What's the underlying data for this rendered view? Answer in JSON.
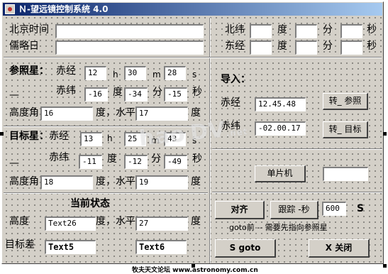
{
  "window": {
    "title": "Ｎ-望远镜控制系统 4.0"
  },
  "time": {
    "beijing_label": "北京时间",
    "julian_label": "儒略日",
    "beijing_value": "",
    "julian_value": ""
  },
  "location": {
    "lat_label": "北纬",
    "lon_label": "东经",
    "deg": "度",
    "min": "分",
    "sec": "秒",
    "lat_deg": "",
    "lat_min": "",
    "lat_sec": "",
    "lon_deg": "",
    "lon_min": "",
    "lon_sec": ""
  },
  "reference": {
    "title": "参照星：",
    "ra_label": "赤经",
    "dec_label": "赤纬",
    "h": "h",
    "m": "m",
    "s": "s",
    "deg": "度",
    "min": "分",
    "sec": "秒",
    "ra_h": "12",
    "ra_m": "30",
    "ra_s": "28",
    "dec_d": "-16",
    "dec_m": "-34",
    "dec_s": "-15",
    "alt_label": "高度角",
    "alt_value": "16",
    "az_label": "度，水平",
    "az_value": "17",
    "az_unit": "度",
    "dash": "—"
  },
  "target": {
    "title": "目标星：",
    "ra_label": "赤经",
    "dec_label": "赤纬",
    "h": "h",
    "m": "m",
    "s": "s",
    "deg": "度",
    "min": "分",
    "sec": "秒",
    "ra_h": "13",
    "ra_m": "25",
    "ra_s": "43",
    "dec_d": "-11",
    "dec_m": "-12",
    "dec_s": "-49",
    "alt_label": "高度角",
    "alt_value": "18",
    "az_label": "度，水平",
    "az_value": "19",
    "az_unit": "度",
    "dash": "—"
  },
  "import": {
    "title": "导入：",
    "ra_label": "赤经",
    "ra_value": "12.45.48",
    "ra_button": "转_ 参照",
    "dec_label": "赤纬",
    "dec_value": "-02.00.17",
    "dec_button": "转_ 目标",
    "mcu_button": "单片机",
    "mcu_value": ""
  },
  "status": {
    "title": "当前状态",
    "alt_label": "高度",
    "alt_value": "Text26",
    "az_label": "度，水平",
    "az_value": "27",
    "az_unit": "度",
    "diff_label": "目标差",
    "diff_alt": "Text5",
    "diff_az": "Text6"
  },
  "controls": {
    "align_button": "对齐",
    "track_button": "跟踪 -秒",
    "track_seconds": "600",
    "track_unit": "S",
    "goto_hint": "goto前 -- 需要先指向参照星",
    "goto_button": "S  goto",
    "close_button": "X 关闭"
  },
  "overlay": {
    "watermark": "hao DV",
    "watermark_suffix": ".net",
    "footer": "牧夫天文论坛 www.astronomy.com.cn"
  }
}
